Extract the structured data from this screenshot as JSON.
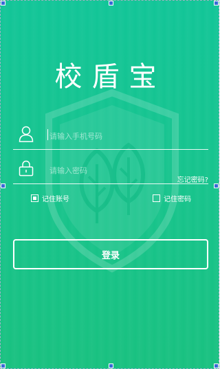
{
  "app": {
    "title": "校盾宝"
  },
  "login": {
    "phone_placeholder": "请输入手机号码",
    "password_placeholder": "请输入密码",
    "forgot_label": "忘记密码?",
    "remember_account_label": "记住账号",
    "remember_account_checked": true,
    "remember_password_label": "记住密码",
    "remember_password_checked": false,
    "submit_label": "登录"
  },
  "icons": {
    "phone_field": "user-icon",
    "password_field": "lock-icon",
    "background": "shield-tree-icon"
  },
  "colors": {
    "background_top": "#12c598",
    "background_bottom": "#19c180",
    "foreground": "#ffffff"
  }
}
